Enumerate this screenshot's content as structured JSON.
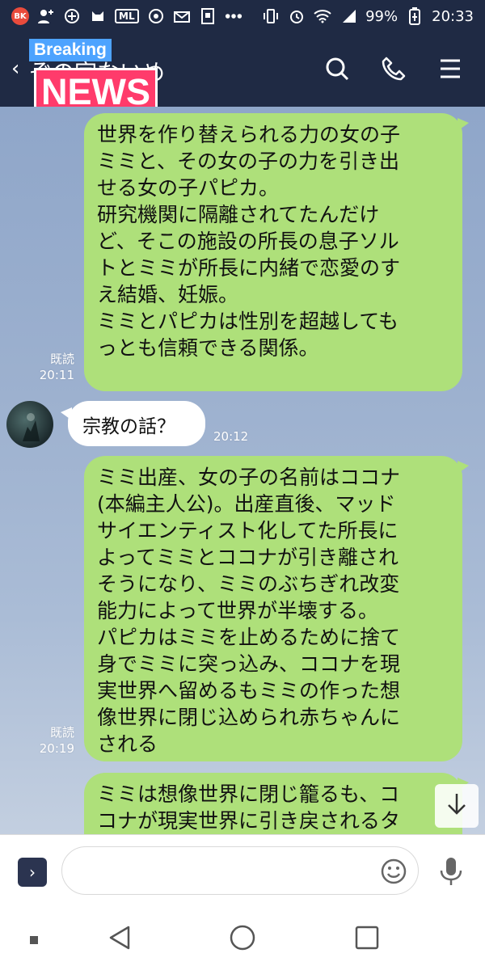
{
  "status_bar": {
    "battery_percent": "99%",
    "time": "20:33",
    "icons": [
      "burger-king-app-icon",
      "add-user-icon",
      "circle-app-icon",
      "cat-app-icon",
      "ml-app-icon",
      "settings-app-icon",
      "mail-icon",
      "pixel-app-icon",
      "more-dots-icon",
      "vibrate-icon",
      "alarm-icon",
      "wifi-icon",
      "signal-icon",
      "battery-saver-icon"
    ]
  },
  "header": {
    "chat_title": "ぞの宗ないめ",
    "overlay_breaking": "Breaking",
    "overlay_news": "NEWS"
  },
  "messages": [
    {
      "type": "sent",
      "text": "世界を作り替えられる力の女の子\nミミと、その女の子の力を引き出\nせる女の子パピカ。\n研究機関に隔離されてたんだけ\nど、そこの施設の所長の息子ソル\nトとミミが所長に内緒で恋愛のす\nえ結婚、妊娠。\nミミとパピカは性別を超越しても\nっとも信頼できる関係。",
      "read": "既読",
      "time": "20:11"
    },
    {
      "type": "received",
      "text": "宗教の話？",
      "time": "20:12"
    },
    {
      "type": "sent",
      "text": "ミミ出産、女の子の名前はココナ\n(本編主人公)。出産直後、マッド\nサイエンティスト化してた所長に\nよってミミとココナが引き離され\nそうになり、ミミのぶちぎれ改変\n能力によって世界が半壊する。\nパピカはミミを止めるために捨て\n身でミミに突っ込み、ココナを現\n実世界へ留めるもミミの作った想\n像世界に閉じ込められ赤ちゃんに\nされる",
      "read": "既読",
      "time": "20:19"
    },
    {
      "type": "sent",
      "text": "ミミは想像世界に閉じ籠るも、コ\nコナが現実世界に引き戻されるタ",
      "read": "",
      "time": ""
    }
  ],
  "input": {
    "placeholder": ""
  },
  "colors": {
    "header_bg": "#1f2a44",
    "sent_bubble": "#aee07a",
    "received_bubble": "#ffffff",
    "chat_bg": "#8fa6c9"
  }
}
